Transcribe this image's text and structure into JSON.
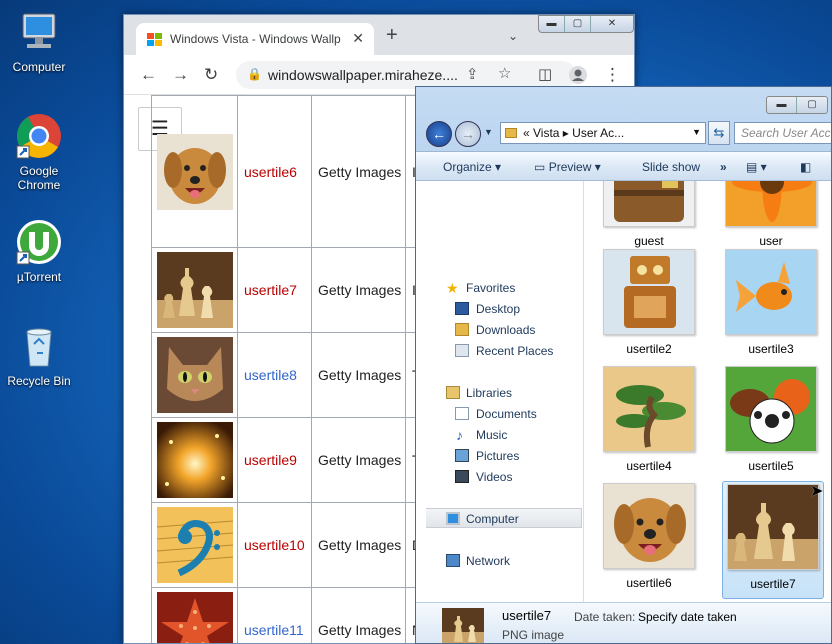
{
  "desktop": {
    "icons": [
      {
        "label": "Computer"
      },
      {
        "label": "Google Chrome"
      },
      {
        "label": "µTorrent"
      },
      {
        "label": "Recycle Bin"
      }
    ]
  },
  "browser": {
    "tab_title": "Windows Vista - Windows Wallp",
    "url": "windowswallpaper.miraheze....",
    "rows": [
      {
        "name": "usertile6",
        "source": "Getty Images",
        "more": "Ic",
        "link_color": "red"
      },
      {
        "name": "usertile7",
        "source": "Getty Images",
        "more": "Ic",
        "link_color": "red"
      },
      {
        "name": "usertile8",
        "source": "Getty Images",
        "more": "To",
        "link_color": "blue"
      },
      {
        "name": "usertile9",
        "source": "Getty Images",
        "more": "To",
        "link_color": "red"
      },
      {
        "name": "usertile10",
        "source": "Getty Images",
        "more": "D",
        "link_color": "red"
      },
      {
        "name": "usertile11",
        "source": "Getty Images",
        "more": "N",
        "link_color": "blue"
      }
    ]
  },
  "explorer": {
    "address": "« Vista ▸ User Ac...",
    "search_placeholder": "Search User Acco...",
    "commands": {
      "organize": "Organize",
      "preview": "Preview",
      "slideshow": "Slide show",
      "more": "»"
    },
    "nav": {
      "favorites": "Favorites",
      "desktop": "Desktop",
      "downloads": "Downloads",
      "recent": "Recent Places",
      "libraries": "Libraries",
      "documents": "Documents",
      "music": "Music",
      "pictures": "Pictures",
      "videos": "Videos",
      "computer": "Computer",
      "network": "Network"
    },
    "tiles": [
      {
        "label": "guest"
      },
      {
        "label": "user"
      },
      {
        "label": "usertile2"
      },
      {
        "label": "usertile3"
      },
      {
        "label": "usertile4"
      },
      {
        "label": "usertile5"
      },
      {
        "label": "usertile6"
      },
      {
        "label": "usertile7"
      }
    ],
    "details": {
      "name": "usertile7",
      "type": "PNG image",
      "date_label": "Date taken:",
      "date_value": "Specify date taken"
    }
  },
  "colors": {
    "link_red": "#ba0000",
    "link_blue": "#3366cc",
    "desktop_blue": "#1668bf"
  }
}
